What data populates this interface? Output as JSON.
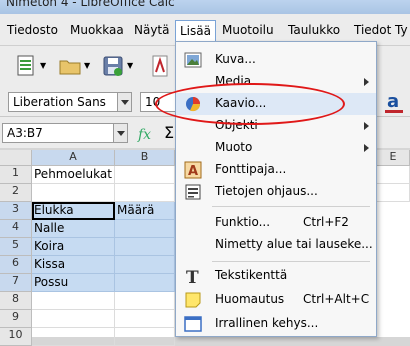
{
  "window": {
    "title": "Nimetön 4 - LibreOffice Calc"
  },
  "menubar": {
    "items": [
      "Tiedosto",
      "Muokkaa",
      "Näytä",
      "Lisää",
      "Muotoilu",
      "Taulukko",
      "Tiedot",
      "Ty"
    ]
  },
  "toolbar": {
    "font_name": "Liberation Sans",
    "font_size": "10"
  },
  "formula_bar": {
    "name_box": "A3:B7",
    "fx_icon": "fx-icon",
    "sum_symbol": "Σ"
  },
  "sheet": {
    "columns": [
      "A",
      "B",
      "E"
    ],
    "rows": [
      "1",
      "2",
      "3",
      "4",
      "5",
      "6",
      "7",
      "8",
      "9",
      "10"
    ],
    "cells": {
      "a1": "Pehmoelukat",
      "a3": "Elukka",
      "b3": "Määrä",
      "a4": "Nalle",
      "a5": "Koira",
      "a6": "Kissa",
      "a7": "Possu"
    }
  },
  "insert_menu": {
    "items": [
      {
        "label": "Kuva...",
        "shortcut": "",
        "icon": "image-icon"
      },
      {
        "label": "Media",
        "shortcut": "",
        "icon": ""
      },
      {
        "label": "Kaavio...",
        "shortcut": "",
        "icon": "chart-icon"
      },
      {
        "label": "Objekti",
        "shortcut": "",
        "icon": ""
      },
      {
        "label": "Muoto",
        "shortcut": "",
        "icon": ""
      },
      {
        "label": "Fonttipaja...",
        "shortcut": "",
        "icon": "fontwork-icon"
      },
      {
        "label": "Tietojen ohjaus...",
        "shortcut": "",
        "icon": "form-control-icon"
      },
      {
        "label": "Funktio...",
        "shortcut": "Ctrl+F2",
        "icon": ""
      },
      {
        "label": "Nimetty alue tai lauseke...",
        "shortcut": "",
        "icon": ""
      },
      {
        "label": "Tekstikenttä",
        "shortcut": "",
        "icon": "text-box-icon"
      },
      {
        "label": "Huomautus",
        "shortcut": "Ctrl+Alt+C",
        "icon": "comment-icon"
      },
      {
        "label": "Irrallinen kehys...",
        "shortcut": "",
        "icon": "frame-icon"
      }
    ]
  },
  "colors": {
    "selection": "#c6dbf2",
    "highlight_ellipse": "#e01818",
    "menu_hover": "#dde8f6"
  }
}
